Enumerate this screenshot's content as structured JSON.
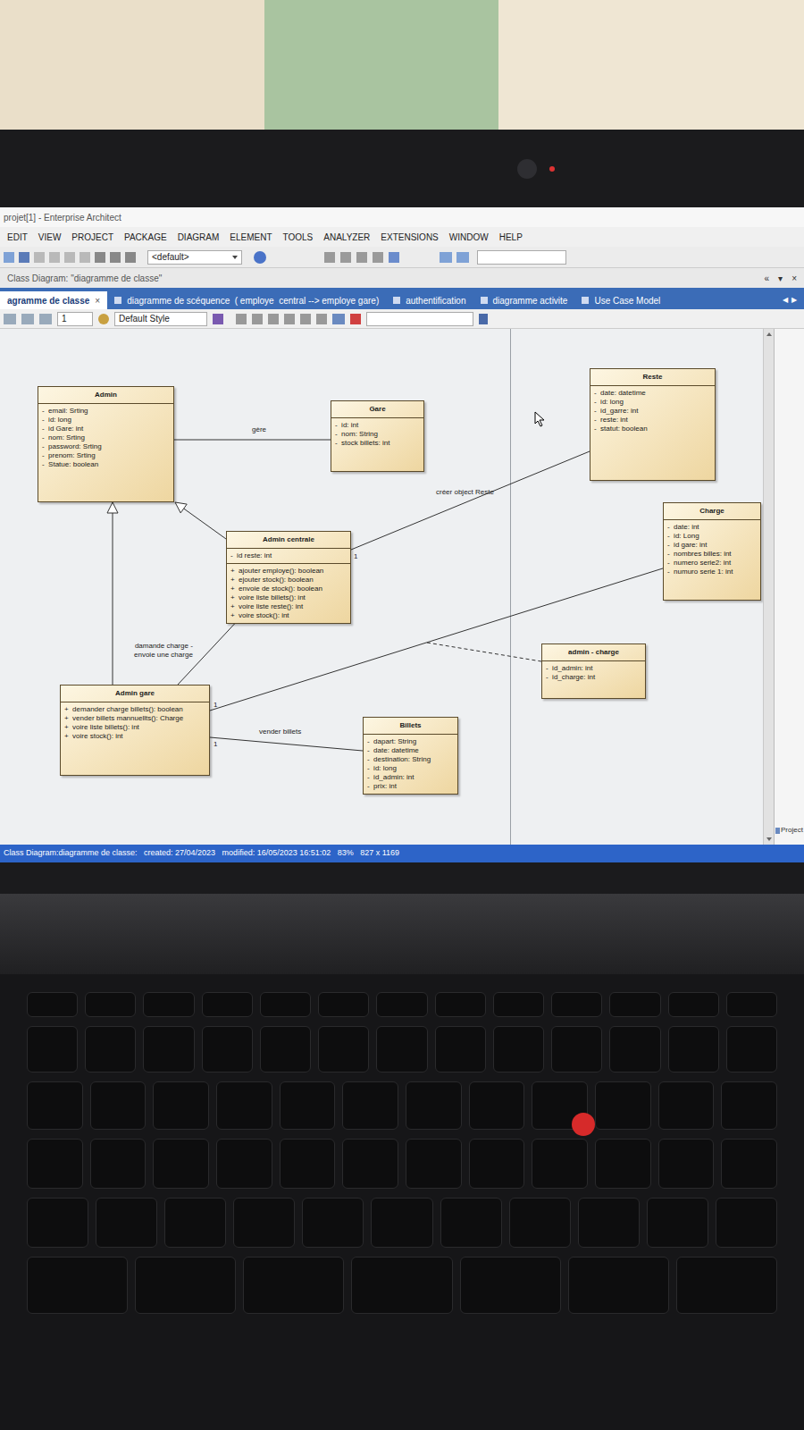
{
  "window": {
    "title": "projet[1] - Enterprise Architect"
  },
  "menu": [
    "EDIT",
    "VIEW",
    "PROJECT",
    "PACKAGE",
    "DIAGRAM",
    "ELEMENT",
    "TOOLS",
    "ANALYZER",
    "EXTENSIONS",
    "WINDOW",
    "HELP"
  ],
  "toolbar": {
    "perspective": "<default>"
  },
  "diagram_header": {
    "title": "Class Diagram: \"diagramme de classe\"",
    "controls": [
      "«",
      "▾",
      "×"
    ]
  },
  "tabs": [
    {
      "label": "agramme de classe",
      "selected": true
    },
    {
      "label": "diagramme de scéquence  ( employe  central --> employe gare)",
      "selected": false
    },
    {
      "label": "authentification",
      "selected": false
    },
    {
      "label": "diagramme activite",
      "selected": false
    },
    {
      "label": "Use Case Model",
      "selected": false
    }
  ],
  "tab_close": "×",
  "tab_scroll": [
    "◀",
    "▶"
  ],
  "diagram_toolbar": {
    "line_width": "1",
    "style": "Default Style"
  },
  "classes": [
    {
      "name": "Admin",
      "attributes": [
        "-  email: Srting",
        "-  id: long",
        "-  id Gare: int",
        "-  nom: Srting",
        "-  password: Srting",
        "-  prenom: Srting",
        "-  Statue: boolean"
      ],
      "operations": []
    },
    {
      "name": "Gare",
      "attributes": [
        "-  id: int",
        "-  nom: String",
        "-  stock billets: int"
      ],
      "operations": []
    },
    {
      "name": "Reste",
      "attributes": [
        "-  date: datetime",
        "-  id: long",
        "-  id_garre: int",
        "-  reste: int",
        "-  statut: boolean"
      ],
      "operations": []
    },
    {
      "name": "Charge",
      "attributes": [
        "-  date: int",
        "-  id: Long",
        "-  id gare: int",
        "-  nombres billes: int",
        "-  numero serie2: int",
        "-  numuro serie 1: int"
      ],
      "operations": []
    },
    {
      "name": "Admin centrale",
      "attributes": [
        "-  id reste: int"
      ],
      "operations": [
        "+  ajouter employe(): boolean",
        "+  ejouter stock(): boolean",
        "+  envoie de stock(): boolean",
        "+  voire liste billets(): int",
        "+  voire liste reste(): int",
        "+  voire stock(): int"
      ]
    },
    {
      "name": "admin - charge",
      "attributes": [
        "-  id_admin: int",
        "-  id_charge: int"
      ],
      "operations": []
    },
    {
      "name": "Admin gare",
      "attributes": [],
      "operations": [
        "+  demander charge billets(): boolean",
        "+  vender billets mannuellts(): Charge",
        "+  voire liste billets(): int",
        "+  voire stock(): int"
      ]
    },
    {
      "name": "Billets",
      "attributes": [
        "-  dapart: String",
        "-  date: datetime",
        "-  destination: String",
        "-  id: long",
        "-  id_admin: int",
        "-  prix: int"
      ],
      "operations": []
    }
  ],
  "relations": [
    {
      "kind": "association",
      "label": "gère",
      "multiplicity": ""
    },
    {
      "kind": "association",
      "label": "créer object Reste",
      "multiplicity": "1"
    },
    {
      "kind": "generalization",
      "label": "",
      "multiplicity": ""
    },
    {
      "kind": "generalization",
      "label": "",
      "multiplicity": ""
    },
    {
      "kind": "association",
      "label": "damande charge -\nenvoie une charge",
      "multiplicity": ""
    },
    {
      "kind": "association",
      "label": "",
      "multiplicity": "1"
    },
    {
      "kind": "dashed",
      "label": "",
      "multiplicity": ""
    },
    {
      "kind": "association",
      "label": "vender billets",
      "multiplicity": "1"
    }
  ],
  "status_bar": "Class Diagram:diagramme de classe:   created: 27/04/2023   modified: 16/05/2023 16:51:02   83%   827 x 1169",
  "side_panel": {
    "label": "Project"
  }
}
